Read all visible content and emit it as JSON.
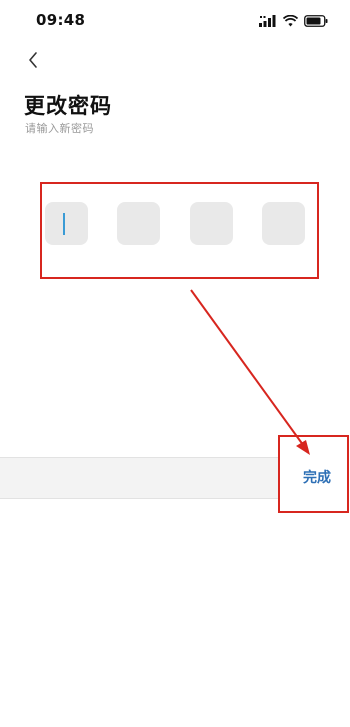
{
  "status_bar": {
    "time": "09:48",
    "icons": [
      "signal-icon",
      "wifi-icon",
      "battery-icon"
    ]
  },
  "header": {
    "back_icon": "chevron-left-icon",
    "title": "更改密码",
    "subtitle": "请输入新密码"
  },
  "code_input": {
    "digits": [
      "",
      "",
      "",
      ""
    ],
    "active_index": 0
  },
  "keyboard_bar": {
    "done_label": "完成"
  },
  "colors": {
    "annotation_red": "#d7261f",
    "cursor_blue": "#3a9bd5",
    "done_blue": "#2d6fb5",
    "digit_box_gray": "#e9e9e9"
  }
}
